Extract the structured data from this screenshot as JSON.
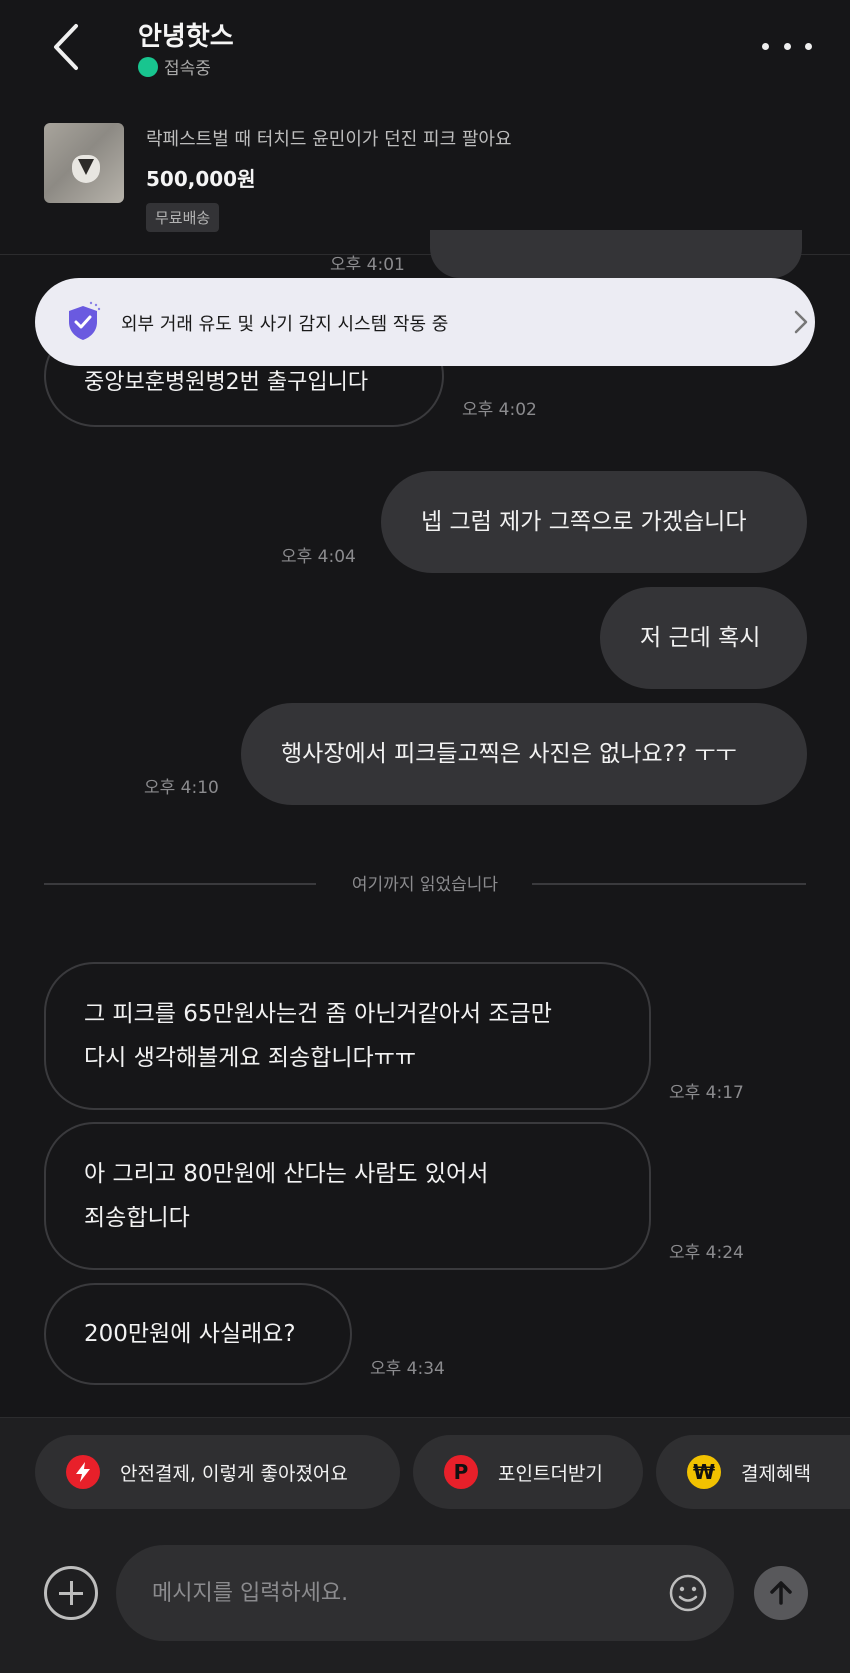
{
  "header": {
    "title": "안녕핫스",
    "status": "접속중",
    "status_color": "#18c58f"
  },
  "product": {
    "name": "락페스트벌 때 터치드 윤민이가 던진 피크 팔아요",
    "price": "500,000원",
    "badge": "무료배송"
  },
  "notice": {
    "text": "외부 거래 유도 및 사기 감지 시스템 작동 중",
    "accent": "#6a5ae0"
  },
  "messages": [
    {
      "time": "오후 4:01"
    },
    {
      "text": "중앙보훈병원병2번 출구입니다",
      "time": "오후 4:02"
    },
    {
      "text": "넵 그럼 제가 그쪽으로 가겠습니다",
      "time": "오후 4:04"
    },
    {
      "text": "저 근데 혹시"
    },
    {
      "text": "행사장에서 피크들고찍은 사진은 없나요?? ㅜㅜ",
      "time": "오후 4:10"
    },
    {
      "line1": "그 피크를 65만원사는건 좀 아닌거같아서 조금만",
      "line2": "다시 생각해볼게요 죄송합니다ㅠㅠ",
      "time": "오후 4:17"
    },
    {
      "line1": "아 그리고 80만원에 산다는 사람도 있어서",
      "line2": "죄송합니다",
      "time": "오후 4:24"
    },
    {
      "text": "200만원에 사실래요?",
      "time": "오후 4:34"
    }
  ],
  "divider": "여기까지 읽었습니다",
  "chips": [
    {
      "label": "안전결제, 이렇게 좋아졌어요",
      "icon": "lightning-icon",
      "color": "#e8202a"
    },
    {
      "label": "포인트더받기",
      "icon_text": "P",
      "color": "#e8202a"
    },
    {
      "label": "결제혜택",
      "icon_text": "₩",
      "color": "#f2c200"
    }
  ],
  "input": {
    "placeholder": "메시지를 입력하세요."
  }
}
